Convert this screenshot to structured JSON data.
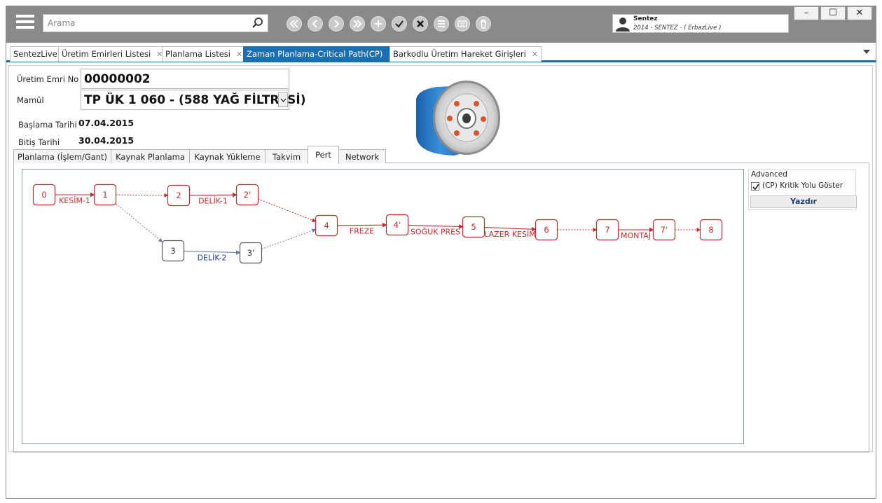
{
  "toolbar": {
    "search_placeholder": "Arama",
    "user": {
      "name": "Sentez",
      "subtitle": "2014 - SENTEZ - ( ErbazLive )"
    }
  },
  "tabs": [
    {
      "label": "SentezLive",
      "closable": false,
      "active": false
    },
    {
      "label": "Üretim Emirleri Listesi",
      "closable": true,
      "active": false
    },
    {
      "label": "Planlama Listesi",
      "closable": true,
      "active": false
    },
    {
      "label": "Zaman Planlama-Critical Path(CP)",
      "closable": true,
      "active": true
    },
    {
      "label": "Barkodlu Üretim Hareket Girişleri",
      "closable": true,
      "active": false
    }
  ],
  "form": {
    "order_no_label": "Üretim Emri No",
    "order_no": "00000002",
    "product_label": "Mamûl",
    "product": "TP ÜK 1 060 - (588 YAĞ FİLTRESİ)",
    "start_label": "Başlama Tarihi",
    "start_date": "07.04.2015",
    "end_label": "Bitiş Tarihi",
    "end_date": "30.04.2015"
  },
  "inner_tabs": [
    {
      "label": "Planlama (İşlem/Gant)",
      "active": false
    },
    {
      "label": "Kaynak Planlama",
      "active": false
    },
    {
      "label": "Kaynak Yükleme",
      "active": false
    },
    {
      "label": "Takvim",
      "active": false
    },
    {
      "label": "Pert",
      "active": true
    },
    {
      "label": "Network",
      "active": false
    }
  ],
  "side": {
    "title": "Advanced",
    "checkbox_label": "(CP) Kritik Yolu Göster",
    "checked": true,
    "print_label": "Yazdır"
  },
  "pert": {
    "nodes": [
      {
        "id": "0",
        "critical": true
      },
      {
        "id": "1",
        "critical": true
      },
      {
        "id": "2",
        "critical": true
      },
      {
        "id": "2'",
        "critical": true
      },
      {
        "id": "3",
        "critical": false
      },
      {
        "id": "3'",
        "critical": false
      },
      {
        "id": "4",
        "critical": true
      },
      {
        "id": "4'",
        "critical": true
      },
      {
        "id": "5",
        "critical": true
      },
      {
        "id": "6",
        "critical": true
      },
      {
        "id": "7",
        "critical": true
      },
      {
        "id": "7'",
        "critical": true
      },
      {
        "id": "8",
        "critical": true
      }
    ],
    "activities": [
      {
        "from": "0",
        "to": "1",
        "label": "KESİM-1",
        "critical": true
      },
      {
        "from": "2",
        "to": "2'",
        "label": "DELİK-1",
        "critical": true
      },
      {
        "from": "3",
        "to": "3'",
        "label": "DELİK-2",
        "critical": false
      },
      {
        "from": "4",
        "to": "4'",
        "label": "FREZE",
        "critical": true
      },
      {
        "from": "4'",
        "to": "5",
        "label": "SOĞUK PRES",
        "critical": true
      },
      {
        "from": "5",
        "to": "6",
        "label": "LAZER KESİM",
        "critical": true
      },
      {
        "from": "7",
        "to": "7'",
        "label": "MONTAJ",
        "critical": true
      }
    ],
    "dummies": [
      {
        "from": "1",
        "to": "2",
        "critical": true
      },
      {
        "from": "1",
        "to": "3",
        "critical": false
      },
      {
        "from": "2'",
        "to": "4",
        "critical": true
      },
      {
        "from": "3'",
        "to": "4",
        "critical": false
      },
      {
        "from": "6",
        "to": "7",
        "critical": true
      },
      {
        "from": "7'",
        "to": "8",
        "critical": true
      }
    ],
    "colors": {
      "critical": "#c42b2b",
      "normal": "#555555",
      "normal_label": "#1f3f9a",
      "dummy_normal": "#6a7fa8"
    }
  }
}
